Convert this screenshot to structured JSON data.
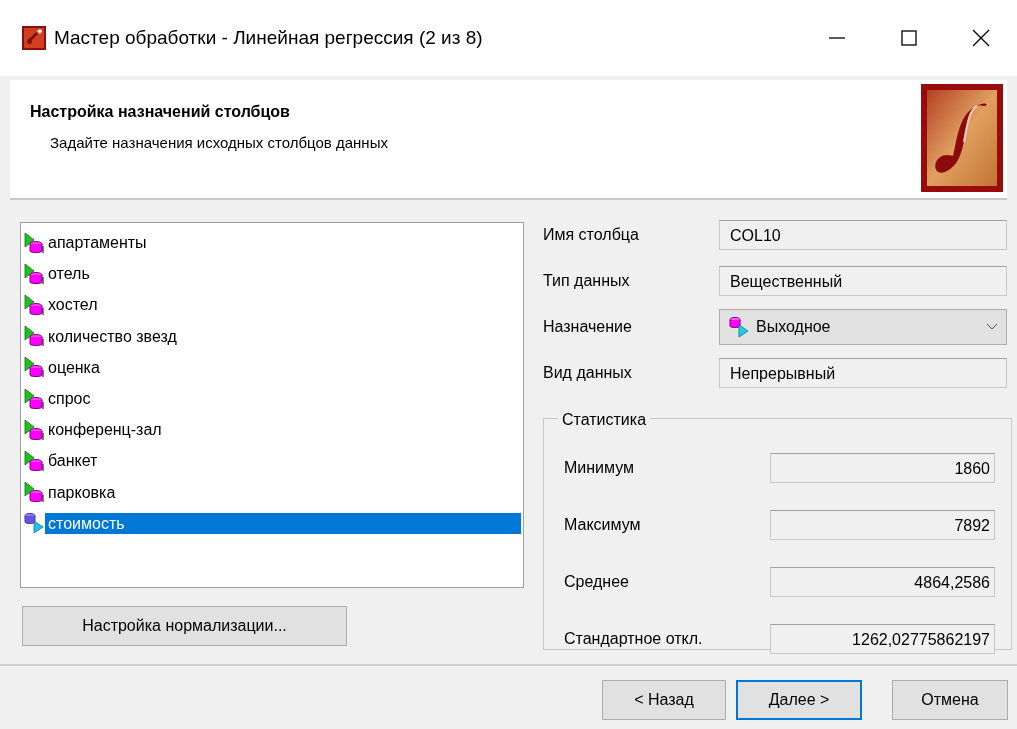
{
  "window": {
    "title": "Мастер обработки - Линейная регрессия (2 из 8)"
  },
  "header": {
    "title": "Настройка назначений столбцов",
    "subtitle": "Задайте назначения исходных столбцов данных"
  },
  "columns": [
    {
      "label": "апартаменты",
      "kind": "input",
      "selected": false
    },
    {
      "label": "отель",
      "kind": "input",
      "selected": false
    },
    {
      "label": "хостел",
      "kind": "input",
      "selected": false
    },
    {
      "label": "количество звезд",
      "kind": "input",
      "selected": false
    },
    {
      "label": "оценка",
      "kind": "input",
      "selected": false
    },
    {
      "label": "спрос",
      "kind": "input",
      "selected": false
    },
    {
      "label": "конференц-зал",
      "kind": "input",
      "selected": false
    },
    {
      "label": "банкет",
      "kind": "input",
      "selected": false
    },
    {
      "label": "парковка",
      "kind": "input",
      "selected": false
    },
    {
      "label": "стоимость",
      "kind": "output",
      "selected": true
    }
  ],
  "normalization_button": "Настройка нормализации...",
  "properties": [
    {
      "label": "Имя столбца",
      "value": "COL10",
      "kind": "text"
    },
    {
      "label": "Тип данных",
      "value": "Вещественный",
      "kind": "text"
    },
    {
      "label": "Назначение",
      "value": "Выходное",
      "kind": "dropdown"
    },
    {
      "label": "Вид данных",
      "value": "Непрерывный",
      "kind": "text"
    }
  ],
  "statistics": {
    "title": "Статистика",
    "rows": [
      {
        "label": "Минимум",
        "value": "1860"
      },
      {
        "label": "Максимум",
        "value": "7892"
      },
      {
        "label": "Среднее",
        "value": "4864,2586"
      },
      {
        "label": "Стандартное откл.",
        "value": "1262,02775862197"
      }
    ]
  },
  "buttons": [
    {
      "label": "< Назад",
      "default": false
    },
    {
      "label": "Далее >",
      "default": true
    },
    {
      "label": "Отмена",
      "default": false
    }
  ]
}
